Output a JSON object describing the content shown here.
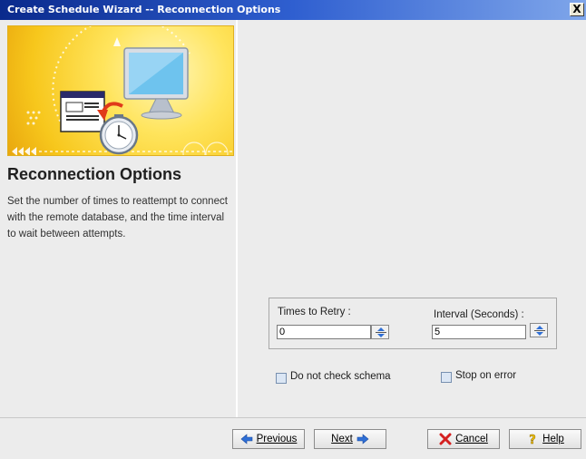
{
  "window": {
    "title": "Create Schedule Wizard -- Reconnection Options",
    "close_glyph": "X"
  },
  "left_panel": {
    "banner_icon": "computer-schedule-clock-illustration",
    "heading": "Reconnection Options",
    "description": "Set the number of times to reattempt to connect with the remote database, and the time interval to wait between attempts."
  },
  "retry_group": {
    "times_label": "Times to Retry :",
    "times_value": "0",
    "interval_label": "Interval (Seconds) :",
    "interval_value": "5"
  },
  "options": {
    "no_schema_check_label": "Do not check schema",
    "no_schema_check_checked": false,
    "stop_on_error_label": "Stop on error",
    "stop_on_error_checked": false
  },
  "buttons": {
    "previous": "Previous",
    "next": "Next",
    "cancel": "Cancel",
    "help": "Help"
  },
  "colors": {
    "titlebar_start": "#0a2a8c",
    "banner_yellow": "#f7c71c",
    "arrow_blue": "#2f6fd6",
    "cancel_red": "#d42020",
    "help_yellow": "#f2c200"
  }
}
